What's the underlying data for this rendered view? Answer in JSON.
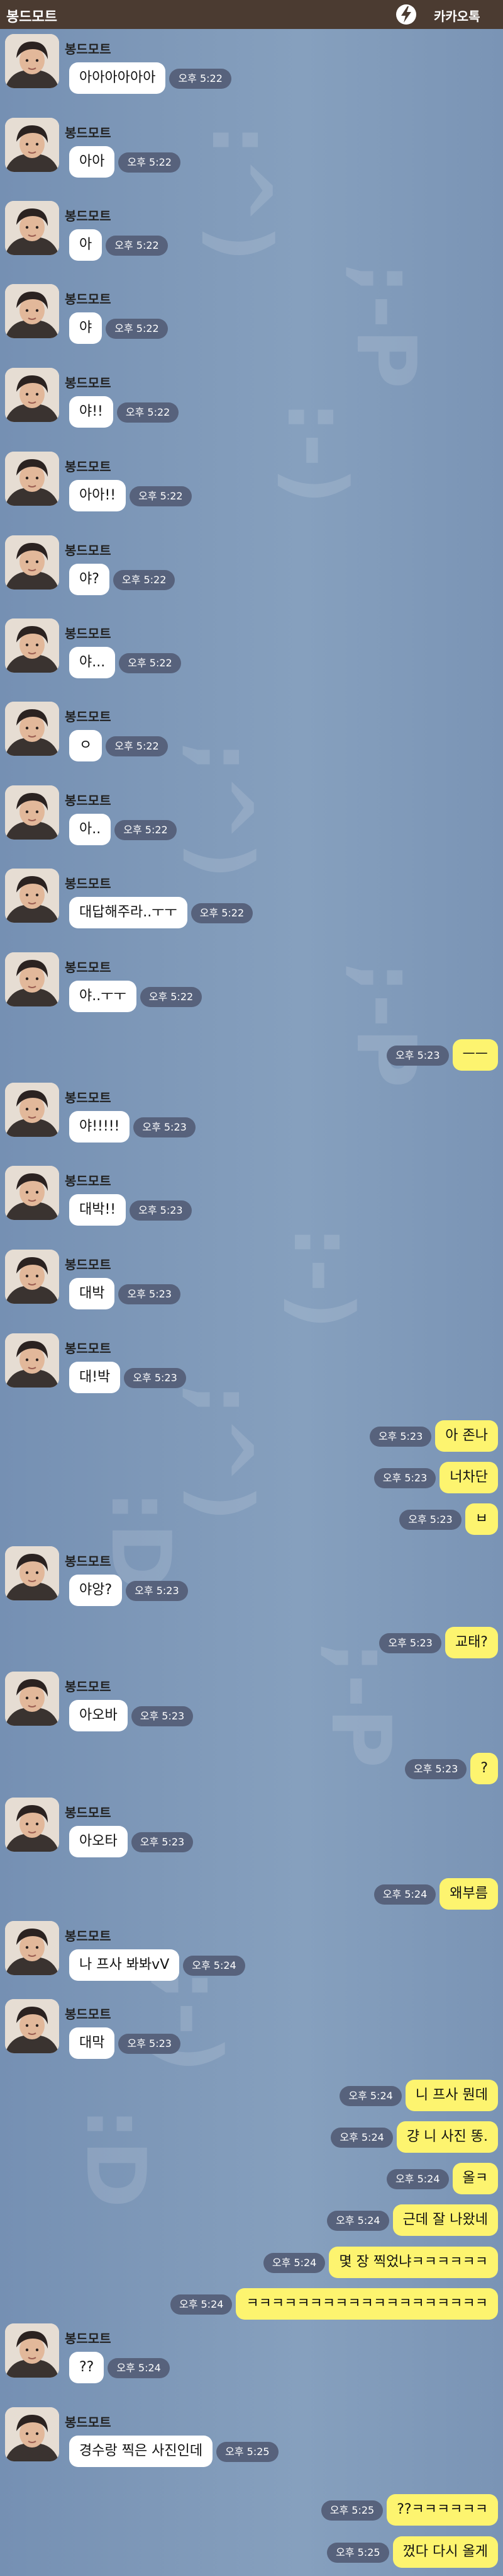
{
  "titlebar": {
    "title": "봉드모트",
    "brand_name": "카카오톡",
    "brand_icon": "lightning-icon"
  },
  "decorations": [
    ":^)",
    ";-P",
    ":-)",
    ";^)",
    ";-P",
    ":-)",
    ";^)",
    ":D",
    ";-P",
    ";-)",
    ":D"
  ],
  "messages": [
    {
      "side": "in",
      "sender": "봉드모트",
      "text": "아아아아아아",
      "time": "오후 5:22"
    },
    {
      "side": "in",
      "sender": "봉드모트",
      "text": "아아",
      "time": "오후 5:22"
    },
    {
      "side": "in",
      "sender": "봉드모트",
      "text": "아",
      "time": "오후 5:22"
    },
    {
      "side": "in",
      "sender": "봉드모트",
      "text": "야",
      "time": "오후 5:22"
    },
    {
      "side": "in",
      "sender": "봉드모트",
      "text": "야!!",
      "time": "오후 5:22"
    },
    {
      "side": "in",
      "sender": "봉드모트",
      "text": "아아!!",
      "time": "오후 5:22"
    },
    {
      "side": "in",
      "sender": "봉드모트",
      "text": "야?",
      "time": "오후 5:22"
    },
    {
      "side": "in",
      "sender": "봉드모트",
      "text": "야...",
      "time": "오후 5:22"
    },
    {
      "side": "in",
      "sender": "봉드모트",
      "text": "ㅇ",
      "time": "오후 5:22"
    },
    {
      "side": "in",
      "sender": "봉드모트",
      "text": "아..",
      "time": "오후 5:22"
    },
    {
      "side": "in",
      "sender": "봉드모트",
      "text": "대답해주라..ㅜㅜ",
      "time": "오후 5:22"
    },
    {
      "side": "in",
      "sender": "봉드모트",
      "text": "야..ㅜㅜ",
      "time": "오후 5:22"
    },
    {
      "side": "out",
      "text": "ㅡㅡ",
      "time": "오후 5:23"
    },
    {
      "side": "in",
      "sender": "봉드모트",
      "text": "야!!!!!",
      "time": "오후 5:23"
    },
    {
      "side": "in",
      "sender": "봉드모트",
      "text": "대박!!",
      "time": "오후 5:23"
    },
    {
      "side": "in",
      "sender": "봉드모트",
      "text": "대박",
      "time": "오후 5:23"
    },
    {
      "side": "in",
      "sender": "봉드모트",
      "text": "대!박",
      "time": "오후 5:23"
    },
    {
      "side": "out",
      "text": "아 존나",
      "time": "오후 5:23"
    },
    {
      "side": "out",
      "text": "너차단",
      "time": "오후 5:23"
    },
    {
      "side": "out",
      "text": "ㅂ",
      "time": "오후 5:23"
    },
    {
      "side": "in",
      "sender": "봉드모트",
      "text": "야앙?",
      "time": "오후 5:23"
    },
    {
      "side": "out",
      "text": "교태?",
      "time": "오후 5:23"
    },
    {
      "side": "in",
      "sender": "봉드모트",
      "text": "아오바",
      "time": "오후 5:23"
    },
    {
      "side": "out",
      "text": "?",
      "time": "오후 5:23"
    },
    {
      "side": "in",
      "sender": "봉드모트",
      "text": "아오타",
      "time": "오후 5:23"
    },
    {
      "side": "out",
      "text": "왜부름",
      "time": "오후 5:24"
    },
    {
      "side": "in",
      "sender": "봉드모트",
      "text": "나 프사 봐봐vV",
      "time": "오후 5:24"
    },
    {
      "side": "in",
      "sender": "봉드모트",
      "text": "대막",
      "time": "오후 5:23"
    },
    {
      "side": "out",
      "text": "니 프사 뭔데",
      "time": "오후 5:24"
    },
    {
      "side": "out",
      "text": "걍 니 사진 똥.",
      "time": "오후 5:24"
    },
    {
      "side": "out",
      "text": "올ㅋ",
      "time": "오후 5:24"
    },
    {
      "side": "out",
      "text": "근데 잘 나왔네",
      "time": "오후 5:24"
    },
    {
      "side": "out",
      "text": "몇 장 찍었냐ㅋㅋㅋㅋㅋㅋ",
      "time": "오후 5:24"
    },
    {
      "side": "out",
      "text": "ㅋㅋㅋㅋㅋㅋㅋㅋㅋㅋㅋㅋㅋㅋㅋㅋㅋㅋㅋ",
      "time": "오후 5:24"
    },
    {
      "side": "in",
      "sender": "봉드모트",
      "text": "??",
      "time": "오후 5:24"
    },
    {
      "side": "in",
      "sender": "봉드모트",
      "text": "경수랑 찍은 사진인데",
      "time": "오후 5:25"
    },
    {
      "side": "out",
      "text": "??ㅋㅋㅋㅋㅋㅋ",
      "time": "오후 5:25"
    },
    {
      "side": "out",
      "text": "껐다 다시 올게",
      "time": "오후 5:25"
    }
  ]
}
